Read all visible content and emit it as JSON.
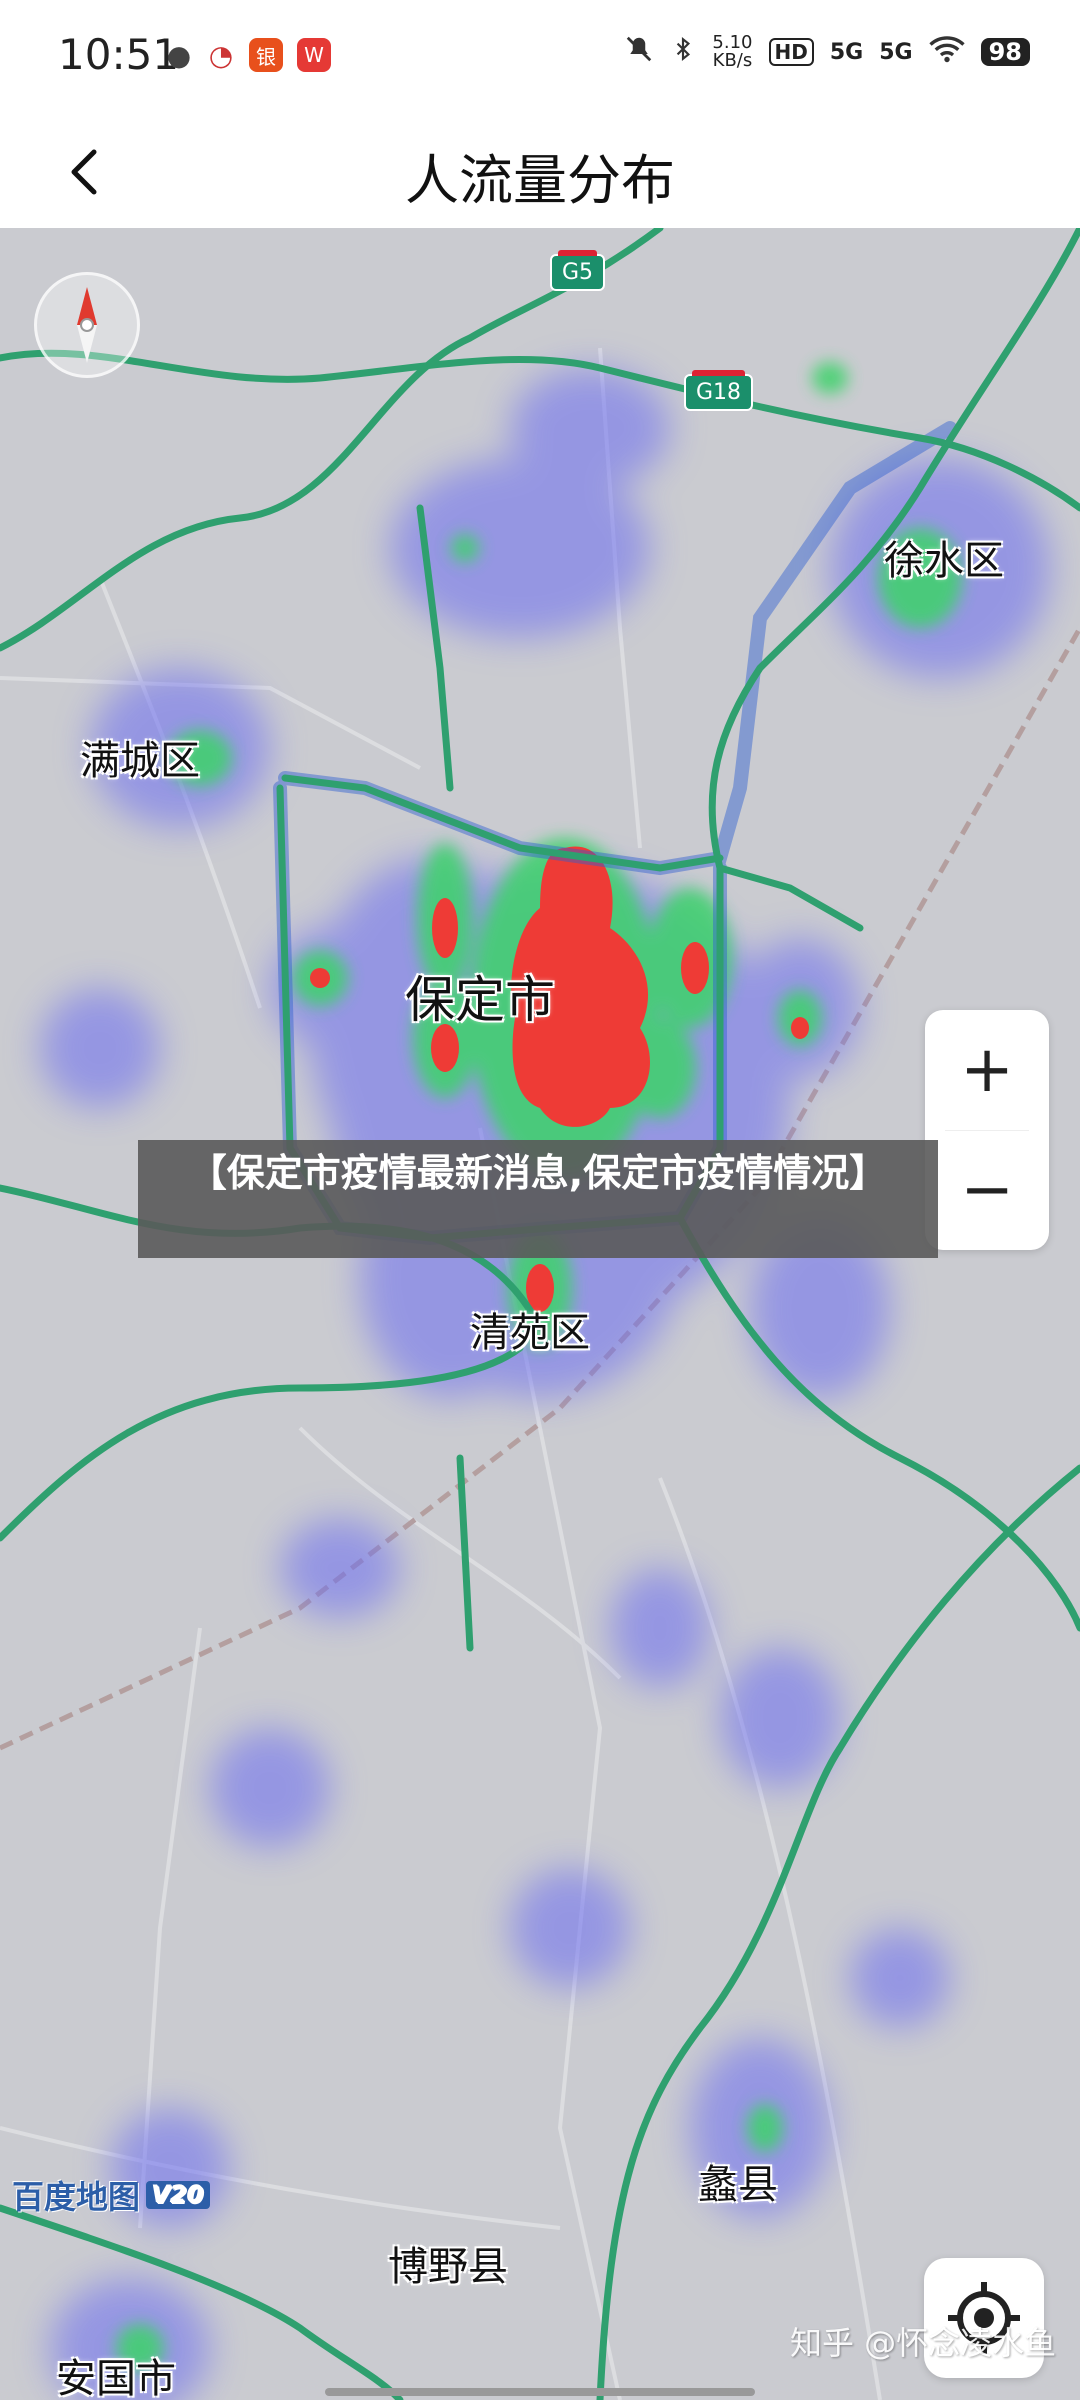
{
  "status_bar": {
    "time": "10:51",
    "app_icons": [
      "wechat-icon",
      "sohu-icon",
      "bank-app-icon",
      "wps-icon"
    ],
    "net_speed_value": "5.10",
    "net_speed_unit": "KB/s",
    "hd_label": "HD",
    "signal1": "5G",
    "signal2": "5G",
    "battery": "98"
  },
  "header": {
    "title": "人流量分布"
  },
  "map": {
    "route_badges": [
      "G5",
      "G18"
    ],
    "labels": {
      "xushui": "徐水区",
      "mancheng": "满城区",
      "baoding": "保定市",
      "qingyuan": "清苑区",
      "lixian": "蠡县",
      "boye": "博野县",
      "anguo": "安国市"
    },
    "zoom_in": "+",
    "zoom_out": "−"
  },
  "caption": "【保定市疫情最新消息,保定市疫情情况】",
  "baidu_logo": {
    "text": "百度地图",
    "version": "V20"
  },
  "watermark": "知乎 @怀念凌水鱼",
  "colors": {
    "highway": "#2fa06f",
    "heat_low": "#6a6cf2",
    "heat_mid": "#3ed36b",
    "heat_high": "#ee3b36"
  }
}
